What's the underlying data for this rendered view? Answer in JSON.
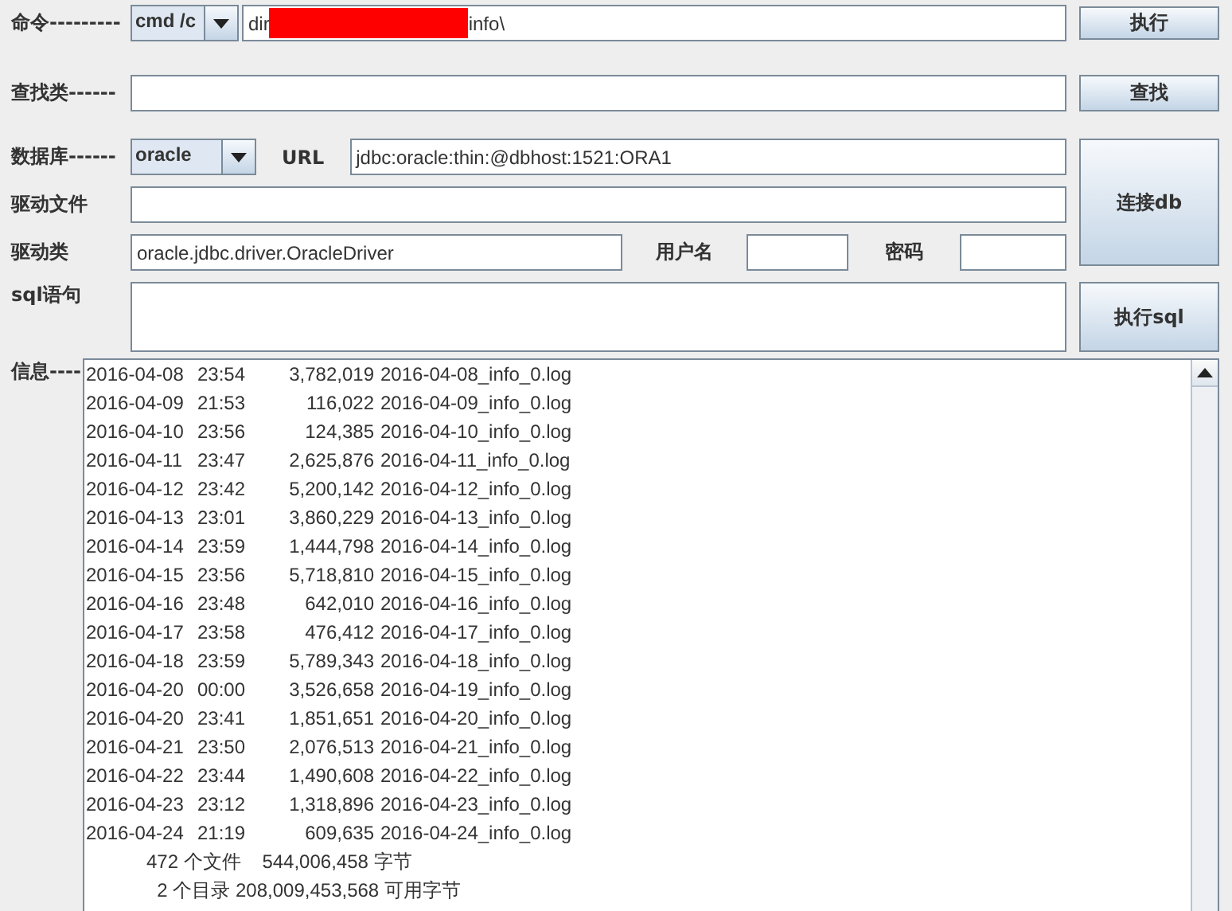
{
  "command": {
    "label": "命令---------",
    "shell": "cmd /c",
    "text_before": "dir",
    "redacted": true,
    "text_after": "info\\",
    "button": "执行"
  },
  "search": {
    "label": "查找类------",
    "button": "查找"
  },
  "database": {
    "label": "数据库------",
    "type": "oracle",
    "url_label": "URL",
    "url": "jdbc:oracle:thin:@dbhost:1521:ORA1",
    "connect_button": "连接db"
  },
  "driver_file": {
    "label": "驱动文件"
  },
  "driver_class": {
    "label": "驱动类",
    "value": "oracle.jdbc.driver.OracleDriver",
    "user_label": "用户名",
    "password_label": "密码"
  },
  "sql": {
    "label": "sql语句",
    "button": "执行sql"
  },
  "output": {
    "label": "信息----",
    "rows": [
      {
        "date": "2016-04-08",
        "time": "23:54",
        "size": "3,782,019",
        "file": "2016-04-08_info_0.log"
      },
      {
        "date": "2016-04-09",
        "time": "21:53",
        "size": "116,022",
        "file": "2016-04-09_info_0.log"
      },
      {
        "date": "2016-04-10",
        "time": "23:56",
        "size": "124,385",
        "file": "2016-04-10_info_0.log"
      },
      {
        "date": "2016-04-11",
        "time": "23:47",
        "size": "2,625,876",
        "file": "2016-04-11_info_0.log"
      },
      {
        "date": "2016-04-12",
        "time": "23:42",
        "size": "5,200,142",
        "file": "2016-04-12_info_0.log"
      },
      {
        "date": "2016-04-13",
        "time": "23:01",
        "size": "3,860,229",
        "file": "2016-04-13_info_0.log"
      },
      {
        "date": "2016-04-14",
        "time": "23:59",
        "size": "1,444,798",
        "file": "2016-04-14_info_0.log"
      },
      {
        "date": "2016-04-15",
        "time": "23:56",
        "size": "5,718,810",
        "file": "2016-04-15_info_0.log"
      },
      {
        "date": "2016-04-16",
        "time": "23:48",
        "size": "642,010",
        "file": "2016-04-16_info_0.log"
      },
      {
        "date": "2016-04-17",
        "time": "23:58",
        "size": "476,412",
        "file": "2016-04-17_info_0.log"
      },
      {
        "date": "2016-04-18",
        "time": "23:59",
        "size": "5,789,343",
        "file": "2016-04-18_info_0.log"
      },
      {
        "date": "2016-04-20",
        "time": "00:00",
        "size": "3,526,658",
        "file": "2016-04-19_info_0.log"
      },
      {
        "date": "2016-04-20",
        "time": "23:41",
        "size": "1,851,651",
        "file": "2016-04-20_info_0.log"
      },
      {
        "date": "2016-04-21",
        "time": "23:50",
        "size": "2,076,513",
        "file": "2016-04-21_info_0.log"
      },
      {
        "date": "2016-04-22",
        "time": "23:44",
        "size": "1,490,608",
        "file": "2016-04-22_info_0.log"
      },
      {
        "date": "2016-04-23",
        "time": "23:12",
        "size": "1,318,896",
        "file": "2016-04-23_info_0.log"
      },
      {
        "date": "2016-04-24",
        "time": "21:19",
        "size": "609,635",
        "file": "2016-04-24_info_0.log"
      }
    ],
    "summary": [
      "472 个文件    544,006,458 字节",
      "  2 个目录 208,009,453,568 可用字节"
    ]
  }
}
